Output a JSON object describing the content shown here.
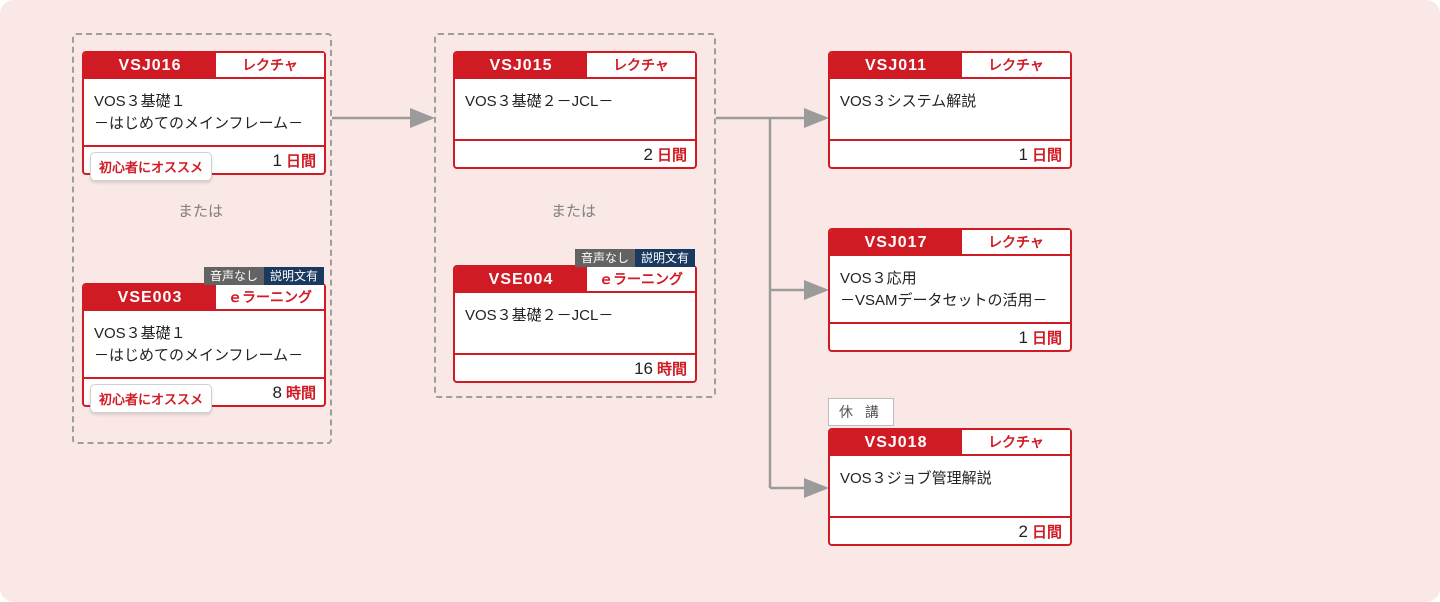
{
  "labels": {
    "or": "または",
    "type_lecture": "レクチャ",
    "type_elearning": "ｅラーニング",
    "badge_beginner": "初心者にオススメ",
    "badge_audio_left": "音声なし",
    "badge_audio_right": "説明文有",
    "status_suspended": "休 講"
  },
  "cards": {
    "a1": {
      "code": "VSJ016",
      "type": "レクチャ",
      "line1": "VOS３基礎１",
      "line2": "－はじめてのメインフレーム－",
      "dur_num": "1",
      "dur_unit": "日間"
    },
    "a2": {
      "code": "VSE003",
      "type": "ｅラーニング",
      "line1": "VOS３基礎１",
      "line2": "－はじめてのメインフレーム－",
      "dur_num": "8",
      "dur_unit": "時間"
    },
    "b1": {
      "code": "VSJ015",
      "type": "レクチャ",
      "line1": "VOS３基礎２－JCL－",
      "dur_num": "2",
      "dur_unit": "日間"
    },
    "b2": {
      "code": "VSE004",
      "type": "ｅラーニング",
      "line1": "VOS３基礎２－JCL－",
      "dur_num": "16",
      "dur_unit": "時間"
    },
    "c1": {
      "code": "VSJ011",
      "type": "レクチャ",
      "line1": "VOS３システム解説",
      "dur_num": "1",
      "dur_unit": "日間"
    },
    "c2": {
      "code": "VSJ017",
      "type": "レクチャ",
      "line1": "VOS３応用",
      "line2": "－VSAMデータセットの活用－",
      "dur_num": "1",
      "dur_unit": "日間"
    },
    "c3": {
      "code": "VSJ018",
      "type": "レクチャ",
      "line1": "VOS３ジョブ管理解説",
      "dur_num": "2",
      "dur_unit": "日間"
    }
  }
}
